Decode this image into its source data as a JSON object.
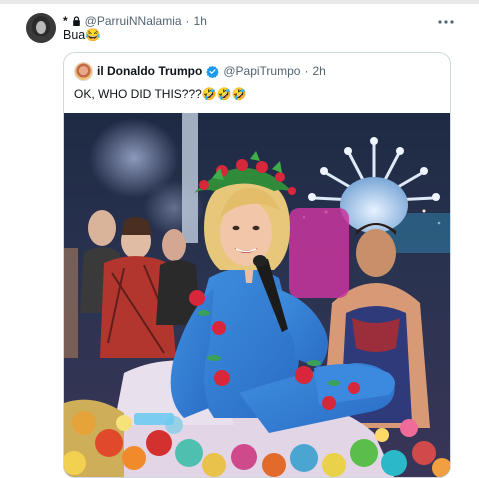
{
  "tweet": {
    "display_name": "*",
    "handle": "@ParruiNNalamia",
    "separator": "·",
    "time": "1h",
    "text": "Bua😂",
    "more_icon": "more-horizontal-icon"
  },
  "quoted": {
    "display_name": "il Donaldo Trumpo",
    "handle": "@PapiTrumpo",
    "separator": "·",
    "time": "2h",
    "text": "OK, WHO DID THIS???🤣🤣🤣",
    "verified_color": "#1d9bf0"
  }
}
